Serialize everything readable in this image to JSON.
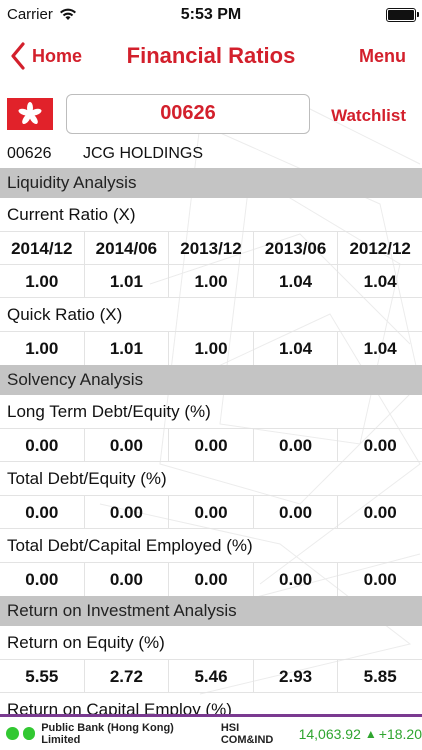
{
  "status_bar": {
    "carrier": "Carrier",
    "time": "5:53 PM"
  },
  "nav": {
    "back_label": "Home",
    "title": "Financial Ratios",
    "menu_label": "Menu"
  },
  "search": {
    "code": "00626",
    "watchlist_label": "Watchlist"
  },
  "stock": {
    "code": "00626",
    "name": "JCG HOLDINGS"
  },
  "years": [
    "2014/12",
    "2014/06",
    "2013/12",
    "2013/06",
    "2012/12"
  ],
  "sections": [
    {
      "title": "Liquidity Analysis",
      "metrics": [
        {
          "label": "Current Ratio (X)",
          "values": [
            "1.00",
            "1.01",
            "1.00",
            "1.04",
            "1.04"
          ]
        },
        {
          "label": "Quick Ratio (X)",
          "values": [
            "1.00",
            "1.01",
            "1.00",
            "1.04",
            "1.04"
          ]
        }
      ]
    },
    {
      "title": "Solvency Analysis",
      "metrics": [
        {
          "label": "Long Term Debt/Equity (%)",
          "values": [
            "0.00",
            "0.00",
            "0.00",
            "0.00",
            "0.00"
          ]
        },
        {
          "label": "Total Debt/Equity (%)",
          "values": [
            "0.00",
            "0.00",
            "0.00",
            "0.00",
            "0.00"
          ]
        },
        {
          "label": "Total Debt/Capital Employed (%)",
          "values": [
            "0.00",
            "0.00",
            "0.00",
            "0.00",
            "0.00"
          ]
        }
      ]
    },
    {
      "title": "Return on Investment Analysis",
      "metrics": [
        {
          "label": "Return on Equity (%)",
          "values": [
            "5.55",
            "2.72",
            "5.46",
            "2.93",
            "5.85"
          ]
        },
        {
          "label": "Return on Capital Employ (%)",
          "values": []
        }
      ]
    }
  ],
  "ticker": {
    "bank": "Public Bank (Hong Kong) Limited",
    "index": "HSI COM&IND",
    "value": "14,063.92",
    "arrow": "▲",
    "change": "+18.20"
  },
  "colors": {
    "accent": "#d3202c",
    "section_bg": "#c4c4c4",
    "ticker_green": "#2fa52f",
    "ticker_border": "#7a3a90"
  }
}
